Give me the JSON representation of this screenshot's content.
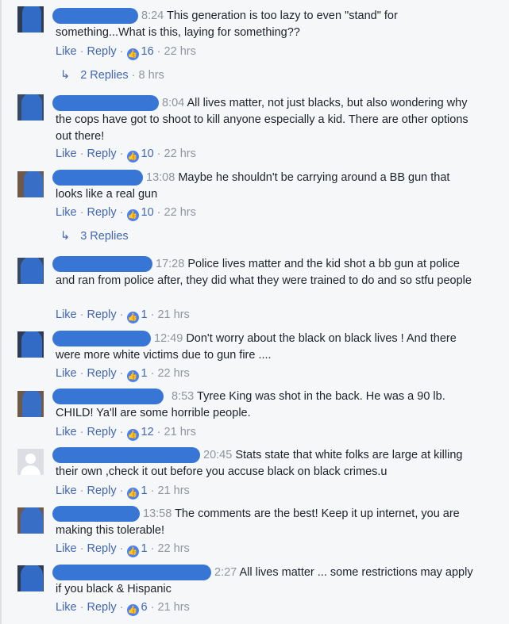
{
  "comments": [
    {
      "time": "8:24",
      "text": "This generation is too lazy to even \"stand\" for something...What is this, laying for something??",
      "like": "Like",
      "reply": "Reply",
      "likes": "16",
      "age": "22 hrs"
    },
    {
      "time": "8:04",
      "text": "All lives matter, not just blacks, but also wondering why the cops have got to shoot to kill anyone especially a kid. There are other options out there!",
      "like": "Like",
      "reply": "Reply",
      "likes": "10",
      "age": "22 hrs"
    },
    {
      "time": "13:08",
      "text": "Maybe he shouldn't be carrying around a BB gun that looks like a real gun",
      "like": "Like",
      "reply": "Reply",
      "likes": "10",
      "age": "22 hrs"
    },
    {
      "time": "17:28",
      "text": "Police lives matter and the kid shot a bb gun at police and ran from police after, they did what they were trained to do and so stfu people",
      "like": "Like",
      "reply": "Reply",
      "likes": "1",
      "age": "21 hrs"
    },
    {
      "time": "12:49",
      "text": "Don't worry about the black on black lives ! And there were more white victims due to gun fire ....",
      "like": "Like",
      "reply": "Reply",
      "likes": "1",
      "age": "22 hrs"
    },
    {
      "time": "8:53",
      "text": "Tyree King was shot in the back. He was a 90 lb. CHILD! Ya'll are some horrible people.",
      "like": "Like",
      "reply": "Reply",
      "likes": "12",
      "age": "21 hrs"
    },
    {
      "time": "20:45",
      "text": "Stats state that white folks are large at killing their own ,check it out before you accuse black on black crimes.u",
      "like": "Like",
      "reply": "Reply",
      "likes": "1",
      "age": "21 hrs"
    },
    {
      "time": "13:58",
      "text": "The comments are the best! Keep it up internet, you are making this tolerable!",
      "like": "Like",
      "reply": "Reply",
      "likes": "1",
      "age": "22 hrs"
    },
    {
      "time": "2:27",
      "text": "All lives matter ... some restrictions may apply if you black & Hispanic",
      "like": "Like",
      "reply": "Reply",
      "likes": "6",
      "age": "21 hrs"
    }
  ],
  "reply_threads": [
    {
      "label": "2 Replies",
      "age": "8 hrs"
    },
    {
      "label": "3 Replies"
    }
  ],
  "separator": "·",
  "colors": {
    "link": "#4267b2",
    "meta": "#90949c",
    "text": "#1d2129",
    "badge": "#4a80f5",
    "redaction": "#2d6fd4"
  },
  "icons": {
    "like_badge": "thumbs-up-icon",
    "reply_arrow": "reply-arrow-icon",
    "default_avatar": "default-avatar-icon"
  }
}
